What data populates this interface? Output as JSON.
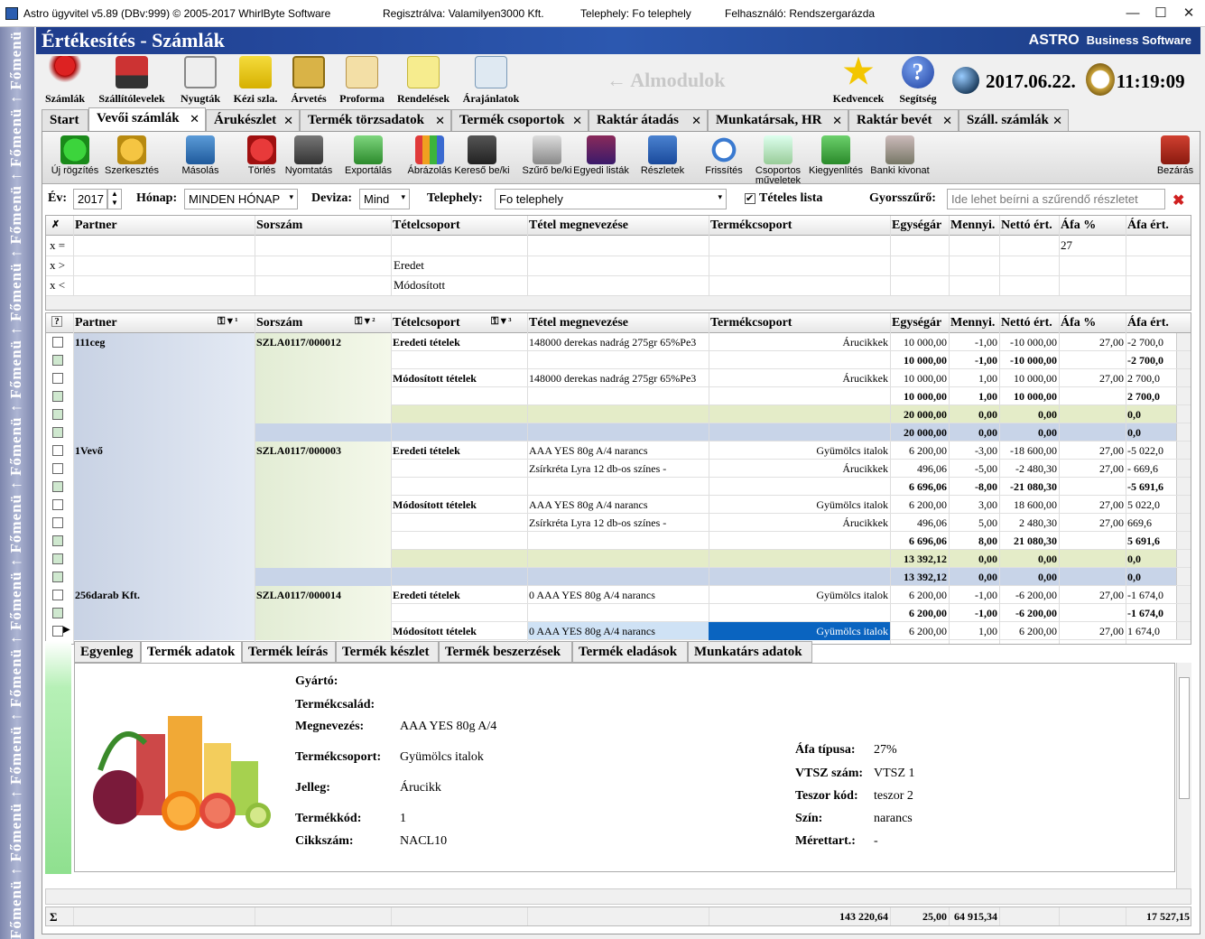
{
  "titlebar": {
    "app": "Astro ügyvitel v5.89 (DBv:999)  © 2005-2017 WhirlByte Software",
    "reg": "Regisztrálva: Valamilyen3000 Kft.",
    "site": "Telephely: Fo telephely",
    "user": "Felhasználó: Rendszergarázda",
    "min": "—",
    "max": "☐",
    "close": "✕"
  },
  "sidebar": {
    "label": "Főmenü ↑ Főmenü ↑ Főmenü ↑ Főmenü ↑ Főmenü ↑ Főmenü ↑ Főmenü ↑ Főmenü ↑ Főmenü ↑ Főmenü ↑ Főmenü ↑ Főmenü ↑ Főmenü ↑ Főmenü ↑ Főmenü ↑ Főmenü ↑ Főmenü ↑ Főmenü ↑ Főmenü ↑ Főmenü ↑ Főmenü ↑ Főmenü ↑"
  },
  "header": {
    "title": "Értékesítés - Számlák",
    "brand_a": "ASTRO",
    "brand_b": "Business Software"
  },
  "modules": [
    "Számlák",
    "Szállítólevelek",
    "Nyugták",
    "Kézi szla.",
    "Árvetés",
    "Proforma",
    "Rendelések",
    "Árajánlatok"
  ],
  "almodulok": "← Almodulok",
  "kedvencek": "Kedvencek",
  "segitseg": "Segítség",
  "date": "2017.06.22.",
  "time": "11:19:09",
  "tabs": [
    "Start",
    "Vevői számlák",
    "Árukészlet",
    "Termék törzsadatok",
    "Termék csoportok",
    "Raktár átadás",
    "Munkatársak, HR",
    "Raktár bevét",
    "Száll. számlák"
  ],
  "actions": [
    "Új rögzítés",
    "Szerkesztés",
    "Másolás",
    "Törlés",
    "Nyomtatás",
    "Exportálás",
    "Ábrázolás",
    "Kereső be/ki",
    "Szűrő be/ki",
    "Egyedi listák",
    "Részletek",
    "Frissítés",
    "Csoportos\nműveletek",
    "Kiegyenlítés",
    "Banki kivonat",
    "Bezárás"
  ],
  "filter": {
    "ev_label": "Év:",
    "ev": "2017",
    "honap_label": "Hónap:",
    "honap": "MINDEN HÓNAP",
    "deviza_label": "Deviza:",
    "deviza": "Mind",
    "telephely_label": "Telephely:",
    "telephely": "Fo telephely",
    "teteles": "Tételes lista",
    "gyors_label": "Gyorsszűrő:",
    "gyors_ph": "Ide lehet beírni a szűrendő részletet"
  },
  "columns": [
    "Partner",
    "Sorszám",
    "Tételcsoport",
    "Tétel megnevezése",
    "Termékcsoport",
    "Egységár",
    "Mennyi.",
    "Nettó ért.",
    "Áfa %",
    "Áfa ért."
  ],
  "filter_rows": {
    "eq": "x =",
    "gt": "x >",
    "lt": "x <",
    "afa_eq": "27",
    "tc_gt": "Eredet",
    "tc_lt": "Módosított"
  },
  "rows": [
    {
      "partner": "111ceg",
      "sorszam": "SZLA0117/000012",
      "group": "Eredeti tételek",
      "name": "148000 derekas nadrág 275gr 65%Pe3",
      "tcs": "Árucikkek",
      "ar": "10 000,00",
      "m": "-1,00",
      "n": "-10 000,00",
      "afa": "27,00",
      "ae": "-2 700,0"
    },
    {
      "ar": "10 000,00",
      "m": "-1,00",
      "n": "-10 000,00",
      "ae": "-2 700,0",
      "sum": 1
    },
    {
      "group": "Módosított tételek",
      "name": "148000 derekas nadrág 275gr 65%Pe3",
      "tcs": "Árucikkek",
      "ar": "10 000,00",
      "m": "1,00",
      "n": "10 000,00",
      "afa": "27,00",
      "ae": "2 700,0"
    },
    {
      "ar": "10 000,00",
      "m": "1,00",
      "n": "10 000,00",
      "ae": "2 700,0",
      "sum": 1
    },
    {
      "ar": "20 000,00",
      "m": "0,00",
      "n": "0,00",
      "ae": "0,0",
      "sum": 2
    },
    {
      "ar": "20 000,00",
      "m": "0,00",
      "n": "0,00",
      "ae": "0,0",
      "sum": 3
    },
    {
      "partner": "1Vevő",
      "sorszam": "SZLA0117/000003",
      "group": "Eredeti tételek",
      "name": "AAA YES 80g A/4  narancs",
      "tcs": "Gyümölcs italok",
      "ar": "6 200,00",
      "m": "-3,00",
      "n": "-18 600,00",
      "afa": "27,00",
      "ae": "-5 022,0"
    },
    {
      "name": "Zsírkréta Lyra 12 db-os színes -",
      "tcs": "Árucikkek",
      "ar": "496,06",
      "m": "-5,00",
      "n": "-2 480,30",
      "afa": "27,00",
      "ae": "- 669,6"
    },
    {
      "ar": "6 696,06",
      "m": "-8,00",
      "n": "-21 080,30",
      "ae": "-5 691,6",
      "sum": 1
    },
    {
      "group": "Módosított tételek",
      "name": "AAA YES 80g A/4  narancs",
      "tcs": "Gyümölcs italok",
      "ar": "6 200,00",
      "m": "3,00",
      "n": "18 600,00",
      "afa": "27,00",
      "ae": "5 022,0"
    },
    {
      "name": "Zsírkréta Lyra 12 db-os színes -",
      "tcs": "Árucikkek",
      "ar": "496,06",
      "m": "5,00",
      "n": "2 480,30",
      "afa": "27,00",
      "ae": "669,6"
    },
    {
      "ar": "6 696,06",
      "m": "8,00",
      "n": "21 080,30",
      "ae": "5 691,6",
      "sum": 1
    },
    {
      "ar": "13 392,12",
      "m": "0,00",
      "n": "0,00",
      "ae": "0,0",
      "sum": 2
    },
    {
      "ar": "13 392,12",
      "m": "0,00",
      "n": "0,00",
      "ae": "0,0",
      "sum": 3
    },
    {
      "partner": "256darab Kft.",
      "sorszam": "SZLA0117/000014",
      "group": "Eredeti tételek",
      "name": "0 AAA YES 80g A/4  narancs",
      "tcs": "Gyümölcs italok",
      "ar": "6 200,00",
      "m": "-1,00",
      "n": "-6 200,00",
      "afa": "27,00",
      "ae": "-1 674,0"
    },
    {
      "ar": "6 200,00",
      "m": "-1,00",
      "n": "-6 200,00",
      "ae": "-1 674,0",
      "sum": 1
    },
    {
      "group": "Módosított tételek",
      "name": "0 AAA YES 80g A/4  narancs",
      "tcs": "Gyümölcs italok",
      "ar": "6 200,00",
      "m": "1,00",
      "n": "6 200,00",
      "afa": "27,00",
      "ae": "1 674,0",
      "sel": 1
    }
  ],
  "bottom_tabs": [
    "Egyenleg",
    "Termék adatok",
    "Termék leírás",
    "Termék készlet",
    "Termék beszerzések",
    "Termék eladások",
    "Munkatárs adatok"
  ],
  "detail": {
    "left": [
      [
        "Gyártó:",
        ""
      ],
      [
        "Termékcsalád:",
        ""
      ],
      [
        "Megnevezés:",
        "AAA YES 80g A/4"
      ],
      [
        "Termékcsoport:",
        "Gyümölcs italok"
      ],
      [
        "Jelleg:",
        "Árucikk"
      ],
      [
        "Termékkód:",
        "1"
      ],
      [
        "Cikkszám:",
        "NACL10"
      ]
    ],
    "right": [
      [
        "Áfa típusa:",
        "27%"
      ],
      [
        "VTSZ szám:",
        "VTSZ 1"
      ],
      [
        "Teszor kód:",
        "teszor 2"
      ],
      [
        "Szín:",
        "narancs"
      ],
      [
        "Mérettart.:",
        "-"
      ]
    ]
  },
  "totals": {
    "sigma": "Σ",
    "ar": "143 220,64",
    "m": "25,00",
    "n": "64 915,34",
    "ae": "17 527,15"
  }
}
